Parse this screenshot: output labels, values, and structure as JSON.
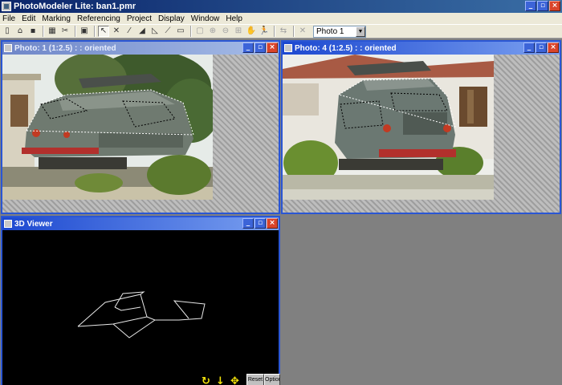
{
  "app": {
    "title": "PhotoModeler Lite: ban1.pmr"
  },
  "menu": [
    "File",
    "Edit",
    "Marking",
    "Referencing",
    "Project",
    "Display",
    "Window",
    "Help"
  ],
  "toolbar": {
    "photo_select_value": "Photo 1",
    "tools": [
      {
        "name": "new-icon",
        "glyph": "▯"
      },
      {
        "name": "open-icon",
        "glyph": "⌂"
      },
      {
        "name": "save-icon",
        "glyph": "▪"
      },
      {
        "name": "sep"
      },
      {
        "name": "project-table-icon",
        "glyph": "▦"
      },
      {
        "name": "cut-mark-icon",
        "glyph": "✂"
      },
      {
        "name": "sep"
      },
      {
        "name": "photo-view-icon",
        "glyph": "▣"
      },
      {
        "name": "sep"
      },
      {
        "name": "pointer-icon",
        "glyph": "↖",
        "pressed": true
      },
      {
        "name": "point-mark-icon",
        "glyph": "✕"
      },
      {
        "name": "line-mark-icon",
        "glyph": "⁄"
      },
      {
        "name": "edge-mark-icon",
        "glyph": "◢"
      },
      {
        "name": "surface-icon",
        "glyph": "◺"
      },
      {
        "name": "curve-icon",
        "glyph": "⟋"
      },
      {
        "name": "cylinder-icon",
        "glyph": "▭"
      },
      {
        "name": "sep"
      },
      {
        "name": "zoom-box-icon",
        "glyph": "▢",
        "disabled": true
      },
      {
        "name": "zoom-in-icon",
        "glyph": "⊕",
        "disabled": true
      },
      {
        "name": "zoom-out-icon",
        "glyph": "⊖",
        "disabled": true
      },
      {
        "name": "zoom-fit-icon",
        "glyph": "⊞",
        "disabled": true
      },
      {
        "name": "pan-icon",
        "glyph": "✋",
        "disabled": true
      },
      {
        "name": "run-process-icon",
        "glyph": "🏃"
      },
      {
        "name": "sep"
      },
      {
        "name": "compare-icon",
        "glyph": "⇆",
        "disabled": true
      },
      {
        "name": "sep"
      },
      {
        "name": "reference-icon",
        "glyph": "✕",
        "disabled": true
      }
    ]
  },
  "windows": {
    "photo1": {
      "title": "Photo: 1 (1:2.5) :  : oriented"
    },
    "photo4": {
      "title": "Photo: 4 (1:2.5) :  : oriented"
    },
    "viewer": {
      "title": "3D Viewer",
      "reset_label": "Reset",
      "options_label": "Options"
    }
  },
  "colors": {
    "active_title": "#1c48d0",
    "wireframe": "#e8e8e8",
    "viewer_controls": "#f2e20a",
    "mdi_background": "#808080"
  }
}
